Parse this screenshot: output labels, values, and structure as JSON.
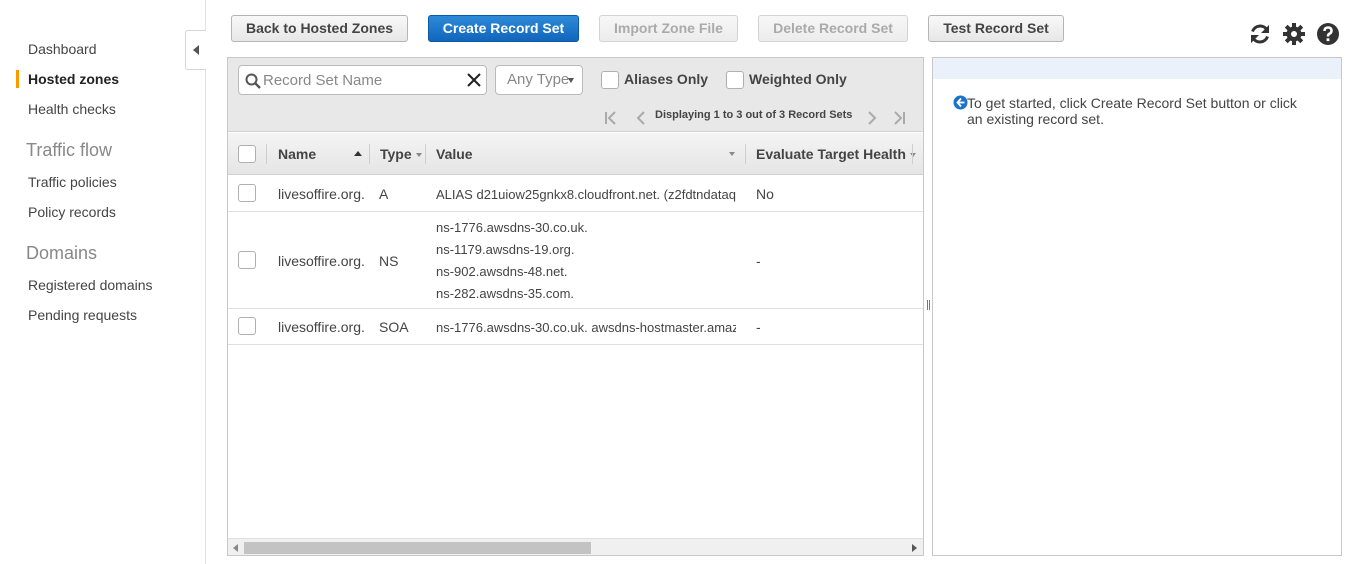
{
  "sidebar": {
    "items": [
      {
        "label": "Dashboard"
      },
      {
        "label": "Hosted zones"
      },
      {
        "label": "Health checks"
      }
    ],
    "traffic_flow": {
      "heading": "Traffic flow",
      "items": [
        {
          "label": "Traffic policies"
        },
        {
          "label": "Policy records"
        }
      ]
    },
    "domains": {
      "heading": "Domains",
      "items": [
        {
          "label": "Registered domains"
        },
        {
          "label": "Pending requests"
        }
      ]
    },
    "accent_color": "#ff9900"
  },
  "toolbar": {
    "back_label": "Back to Hosted Zones",
    "create_label": "Create Record Set",
    "import_label": "Import Zone File",
    "delete_label": "Delete Record Set",
    "test_label": "Test Record Set",
    "icons": [
      "refresh-icon",
      "gear-icon",
      "help-icon"
    ]
  },
  "filters": {
    "search_placeholder": "Record Set Name",
    "search_value": "",
    "type_value": "Any Type",
    "aliases_label": "Aliases Only",
    "weighted_label": "Weighted Only",
    "pager_text": "Displaying 1 to 3 out of 3 Record Sets"
  },
  "table": {
    "columns": [
      "Name",
      "Type",
      "Value",
      "Evaluate Target Health"
    ],
    "rows": [
      {
        "name": "livesoffire.org.",
        "type": "A",
        "value": [
          "ALIAS d21uiow25gnkx8.cloudfront.net. (z2fdtndataq"
        ],
        "eval": "No"
      },
      {
        "name": "livesoffire.org.",
        "type": "NS",
        "value": [
          "ns-1776.awsdns-30.co.uk.",
          "ns-1179.awsdns-19.org.",
          "ns-902.awsdns-48.net.",
          "ns-282.awsdns-35.com."
        ],
        "eval": "-"
      },
      {
        "name": "livesoffire.org.",
        "type": "SOA",
        "value": [
          "ns-1776.awsdns-30.co.uk. awsdns-hostmaster.amaz"
        ],
        "eval": "-"
      }
    ]
  },
  "detail": {
    "hint": "To get started, click Create Record Set button or click an existing record set."
  },
  "colors": {
    "primary_button": "#1166bb",
    "detail_bar": "#eaf1fb",
    "info_icon": "#1a73c8"
  }
}
